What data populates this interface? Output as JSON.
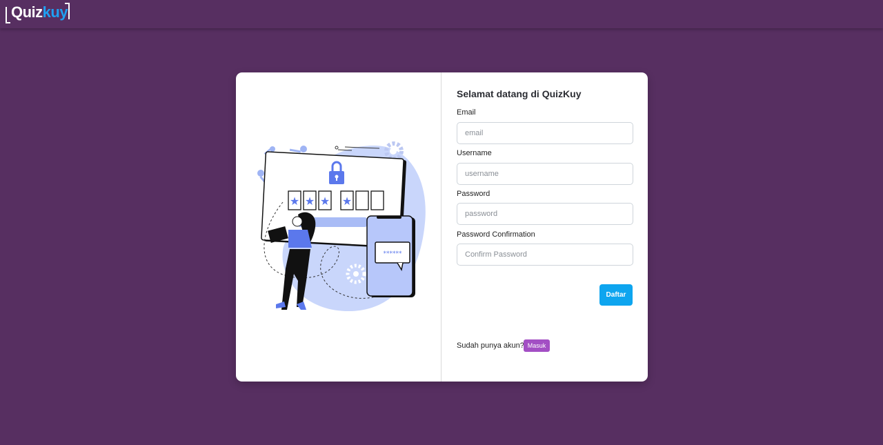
{
  "brand": {
    "logo_part1": "Quiz",
    "logo_part2": "kuy"
  },
  "form": {
    "title": "Selamat datang di QuizKuy",
    "fields": [
      {
        "label": "Email",
        "placeholder": "email",
        "value": ""
      },
      {
        "label": "Username",
        "placeholder": "username",
        "value": ""
      },
      {
        "label": "Password",
        "placeholder": "password",
        "value": ""
      },
      {
        "label": "Password Confirmation",
        "placeholder": "Confirm Password",
        "value": ""
      }
    ],
    "submit_label": "Daftar",
    "login_prompt": "Sudah punya akun?",
    "login_label": "Masuk"
  },
  "illustration": {
    "password_mask": "******"
  },
  "colors": {
    "background": "#572f61",
    "brand_accent": "#1fa0f2",
    "submit_button": "#0ea5ef",
    "login_button": "#a34fc4",
    "illustration_blue": "#5b78ec"
  }
}
